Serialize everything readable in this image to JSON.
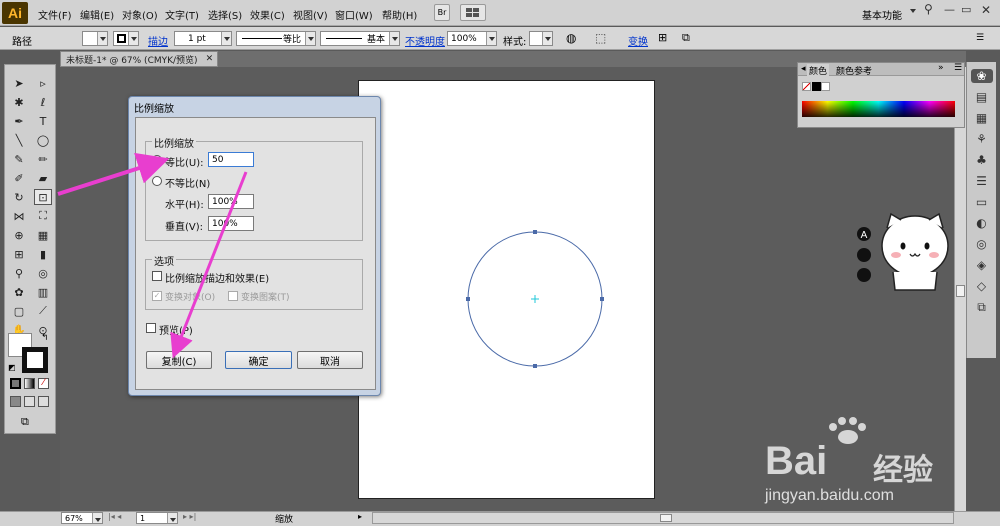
{
  "app": {
    "logo": "Ai",
    "workspace": "基本功能"
  },
  "menu": [
    "文件(F)",
    "编辑(E)",
    "对象(O)",
    "文字(T)",
    "选择(S)",
    "效果(C)",
    "视图(V)",
    "窗口(W)",
    "帮助(H)"
  ],
  "menu_buttons": {
    "bridge": "Br"
  },
  "control": {
    "object_type": "路径",
    "stroke_label": "描边",
    "stroke_weight": "1 pt",
    "profile": "等比",
    "brush": "基本",
    "opacity_label": "不透明度",
    "opacity_value": "100%",
    "style_label": "样式:",
    "transform_label": "变换"
  },
  "tab": {
    "title": "未标题-1* @ 67% (CMYK/预览)"
  },
  "dialog": {
    "title": "比例缩放",
    "group_scale": "比例缩放",
    "uniform_label": "等比(U):",
    "uniform_value": "50",
    "nonuniform_label": "不等比(N)",
    "horizontal_label": "水平(H):",
    "horizontal_value": "100%",
    "vertical_label": "垂直(V):",
    "vertical_value": "100%",
    "group_options": "选项",
    "scale_strokes": "比例缩放描边和效果(E)",
    "transform_objects": "变换对象(O)",
    "transform_patterns": "变换图案(T)",
    "preview": "预览(P)",
    "copy_button": "复制(C)",
    "ok_button": "确定",
    "cancel_button": "取消"
  },
  "color_panel": {
    "tab_color": "颜色",
    "tab_guide": "颜色参考"
  },
  "status": {
    "zoom": "67%",
    "page": "1",
    "tool": "缩放"
  },
  "watermark": {
    "brand": "Bai",
    "brand_cn": "经验",
    "url": "jingyan.baidu.com"
  },
  "colors": {
    "arrow": "#e83ecf",
    "circle_stroke": "#4a6aa8",
    "dialog_frame": "#c7d3e4"
  }
}
